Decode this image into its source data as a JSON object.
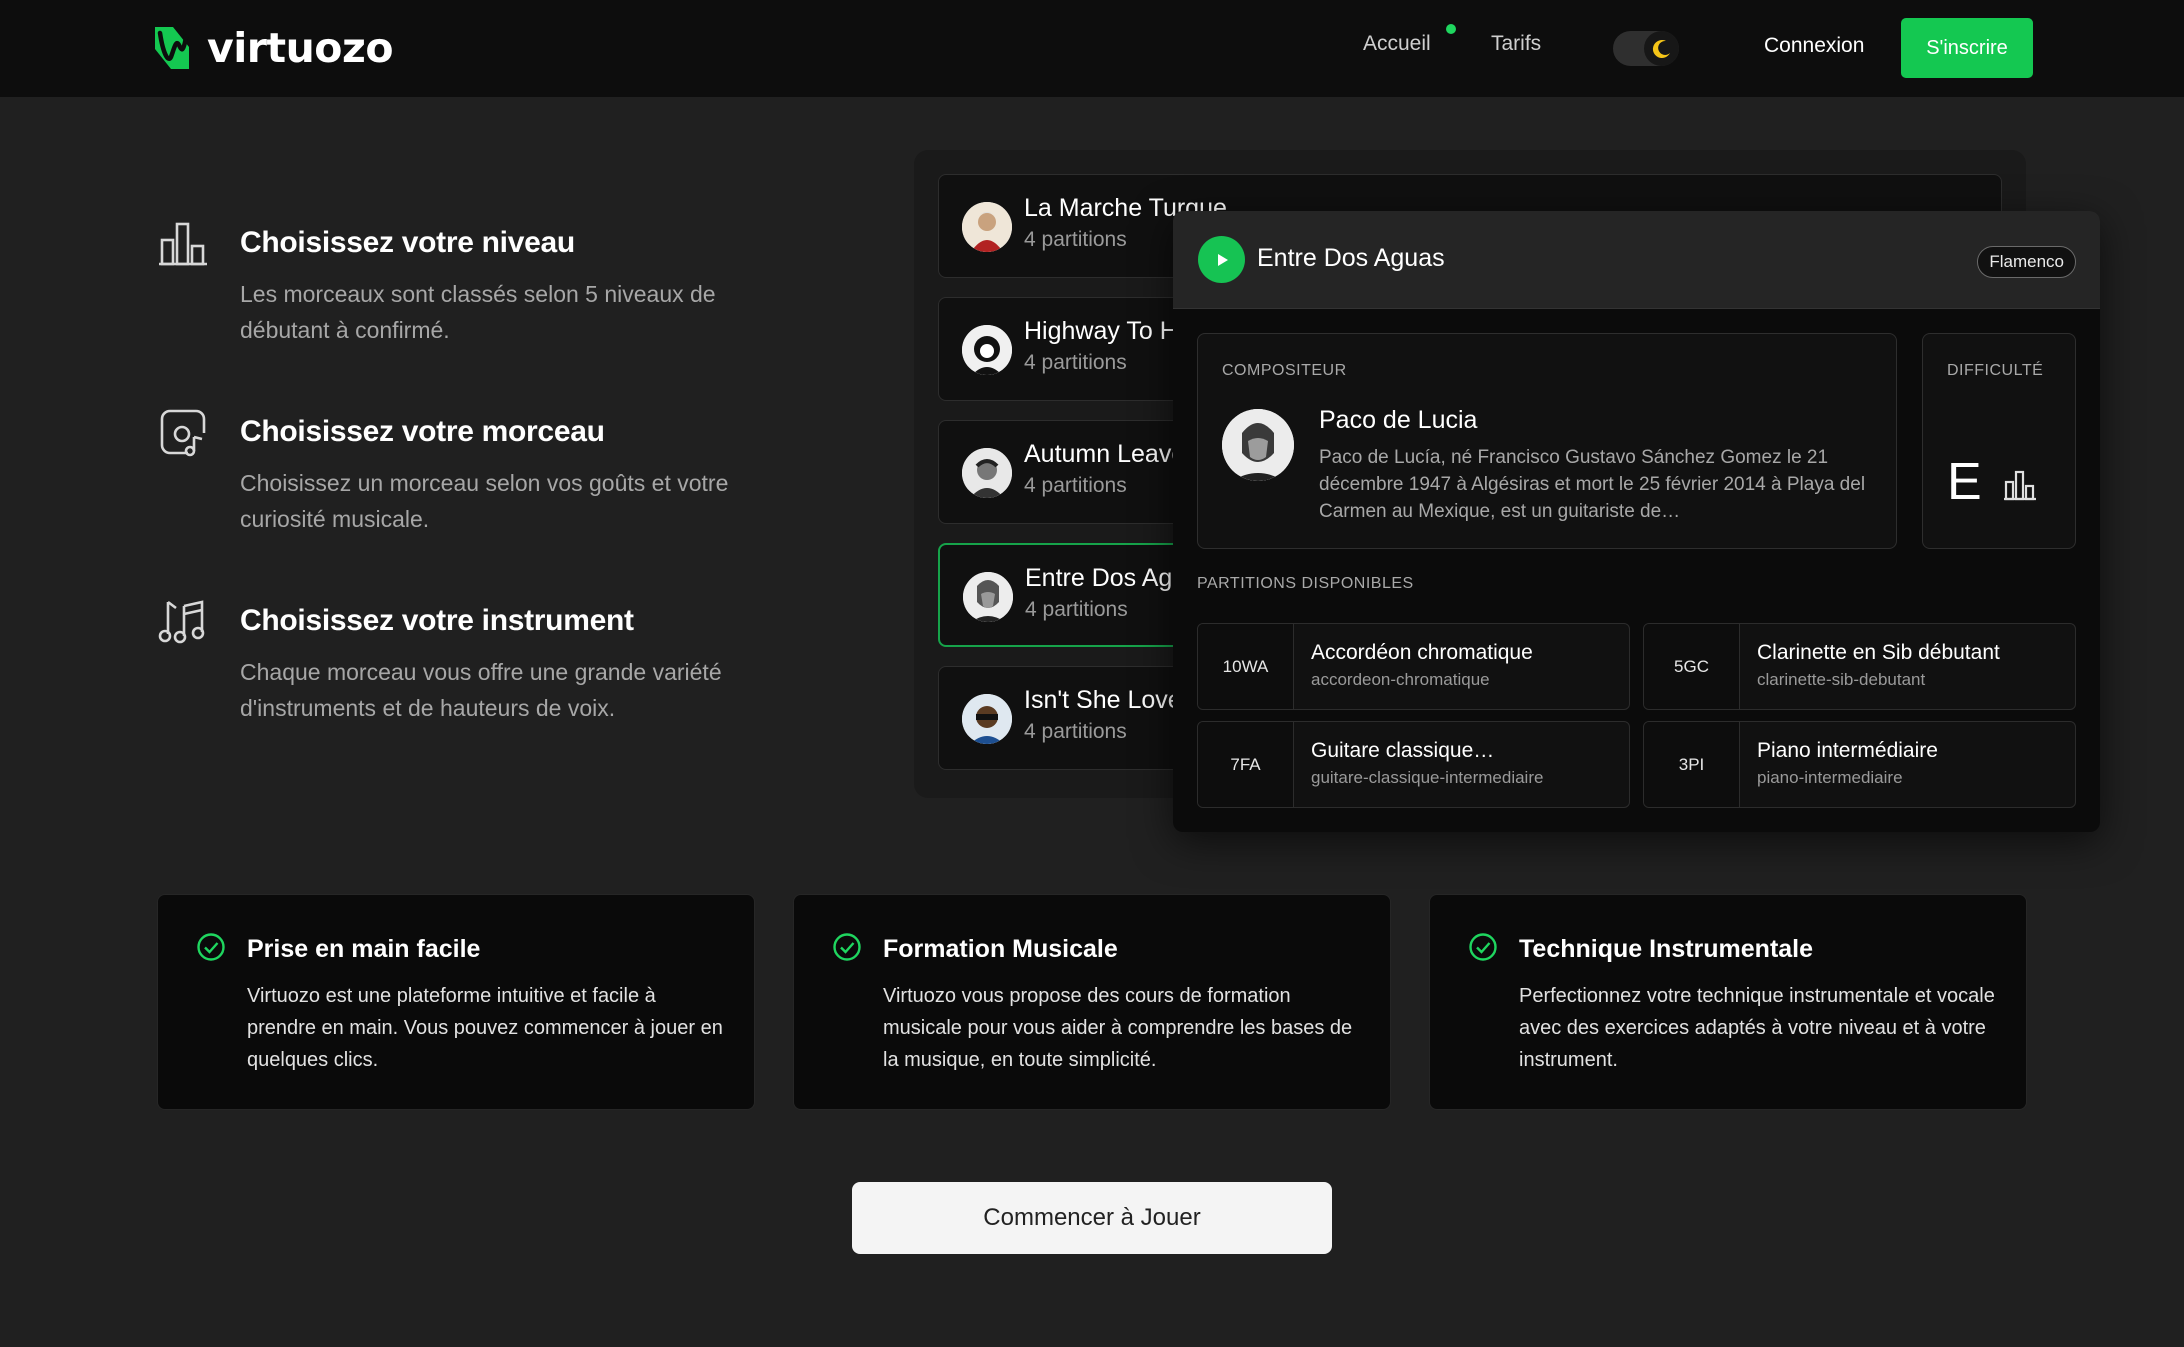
{
  "header": {
    "brand": "virtuozo",
    "nav": {
      "home": "Accueil",
      "pricing": "Tarifs"
    },
    "login": "Connexion",
    "signup": "S'inscrire"
  },
  "steps": [
    {
      "title": "Choisissez votre niveau",
      "desc": "Les morceaux sont classés selon 5 niveaux de débutant à confirmé.",
      "icon": "bar-chart-icon"
    },
    {
      "title": "Choisissez votre morceau",
      "desc": "Choisissez un morceau selon vos goûts et votre curiosité musicale.",
      "icon": "music-file-icon"
    },
    {
      "title": "Choisissez votre instrument",
      "desc": "Chaque morceau vous offre une grande variété d'instruments et de hauteurs de voix.",
      "icon": "music-notes-icon"
    }
  ],
  "songs": [
    {
      "title": "La Marche Turque",
      "sub": "4 partitions"
    },
    {
      "title": "Highway To Hell",
      "sub": "4 partitions"
    },
    {
      "title": "Autumn Leaves",
      "sub": "4 partitions"
    },
    {
      "title": "Entre Dos Aguas",
      "sub": "4 partitions"
    },
    {
      "title": "Isn't She Lovely",
      "sub": "4 partitions"
    }
  ],
  "detail": {
    "title": "Entre Dos Aguas",
    "genre": "Flamenco",
    "composer_label": "COMPOSITEUR",
    "composer_name": "Paco de Lucia",
    "composer_bio": "Paco de Lucía, né Francisco Gustavo Sánchez Gomez le 21 décembre 1947 à Algésiras et mort le 25 février 2014 à Playa del Carmen au Mexique, est un guitariste de…",
    "difficulty_label": "DIFFICULTÉ",
    "difficulty": "E",
    "parts_label": "PARTITIONS DISPONIBLES",
    "parts": [
      {
        "code": "10WA",
        "name": "Accordéon chromatique",
        "slug": "accordeon-chromatique"
      },
      {
        "code": "5GC",
        "name": "Clarinette en Sib débutant",
        "slug": "clarinette-sib-debutant"
      },
      {
        "code": "7FA",
        "name": "Guitare classique…",
        "slug": "guitare-classique-intermediaire"
      },
      {
        "code": "3PI",
        "name": "Piano intermédiaire",
        "slug": "piano-intermediaire"
      }
    ]
  },
  "features": [
    {
      "title": "Prise en main facile",
      "desc": "Virtuozo est une plateforme intuitive et facile à prendre en main. Vous pouvez commencer à jouer en quelques clics."
    },
    {
      "title": "Formation Musicale",
      "desc": "Virtuozo vous propose des cours de formation musicale pour vous aider à comprendre les bases de la musique, en toute simplicité."
    },
    {
      "title": "Technique Instrumentale",
      "desc": "Perfectionnez votre technique instrumentale et vocale avec des exercices adaptés à votre niveau et à votre instrument."
    }
  ],
  "cta": "Commencer à Jouer",
  "colors": {
    "accent": "#14c851",
    "background": "#202020",
    "header": "#0d0d0d",
    "card": "#0a0a0a"
  }
}
